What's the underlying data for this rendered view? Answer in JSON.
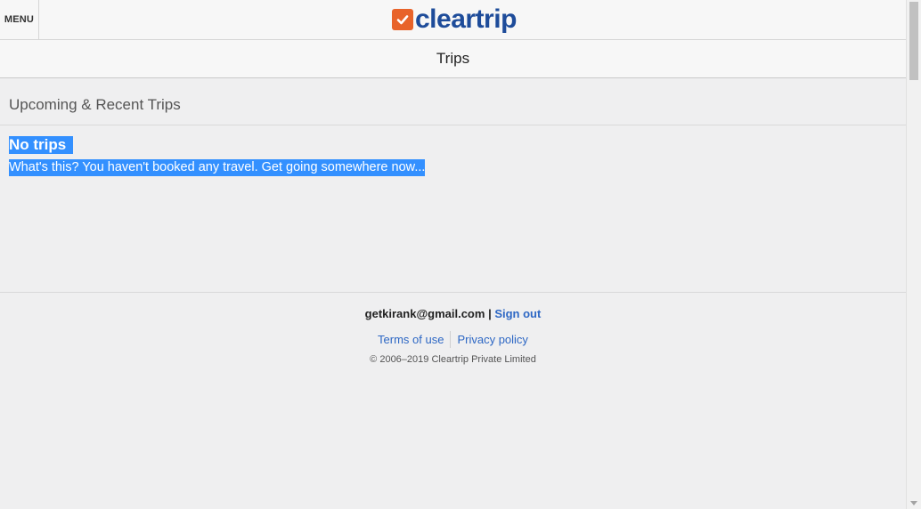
{
  "header": {
    "menu_label": "MENU",
    "logo_text": "cleartrip",
    "brand_color": "#1e4c9a",
    "logo_icon_color": "#e8632a",
    "logo_icon": "check-icon"
  },
  "page_title": "Trips",
  "trips": {
    "heading": "Upcoming & Recent Trips",
    "empty_title": "No trips",
    "empty_message": "What's this? You haven't booked any travel. Get going somewhere now..."
  },
  "footer": {
    "email": "getkirank@gmail.com",
    "separator": "|",
    "sign_out": "Sign out",
    "links": [
      "Terms of use",
      "Privacy policy"
    ],
    "copyright": "© 2006–2019 Cleartrip Private Limited",
    "link_color": "#2d67c4"
  },
  "selection_color": "#3390ff"
}
